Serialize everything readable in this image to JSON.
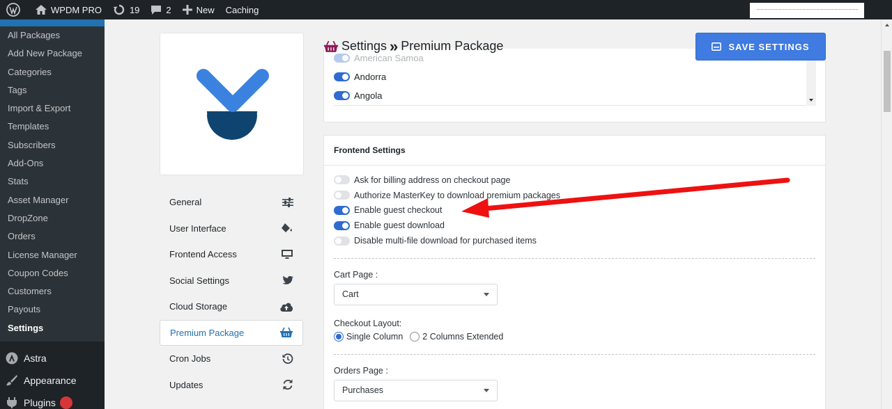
{
  "adminbar": {
    "site_name": "WPDM PRO",
    "updates_count": "19",
    "comments_count": "2",
    "new_label": "New",
    "caching_label": "Caching"
  },
  "adminmenu": {
    "submenu": [
      "All Packages",
      "Add New Package",
      "Categories",
      "Tags",
      "Import & Export",
      "Templates",
      "Subscribers",
      "Add-Ons",
      "Stats",
      "Asset Manager",
      "DropZone",
      "Orders",
      "License Manager",
      "Coupon Codes",
      "Customers",
      "Payouts",
      "Settings"
    ],
    "active": "Settings",
    "astra": "Astra",
    "appearance": "Appearance",
    "plugins": "Plugins"
  },
  "settings_nav": {
    "items": [
      "General",
      "User Interface",
      "Frontend Access",
      "Social Settings",
      "Cloud Storage",
      "Premium Package",
      "Cron Jobs",
      "Updates"
    ],
    "active": "Premium Package"
  },
  "header": {
    "title": "Settings",
    "separator": "»",
    "subtitle": "Premium Package",
    "save_label": "SAVE SETTINGS"
  },
  "countries": [
    {
      "name": "American Samoa",
      "on": true
    },
    {
      "name": "Andorra",
      "on": true
    },
    {
      "name": "Angola",
      "on": true
    }
  ],
  "frontend": {
    "heading": "Frontend Settings",
    "options": [
      {
        "label": "Ask for billing address on checkout page",
        "on": false
      },
      {
        "label": "Authorize MasterKey to download premium packages",
        "on": false
      },
      {
        "label": "Enable guest checkout",
        "on": true
      },
      {
        "label": "Enable guest download",
        "on": true
      },
      {
        "label": "Disable multi-file download for purchased items",
        "on": false
      }
    ],
    "cart_page_label": "Cart Page :",
    "cart_page_value": "Cart",
    "checkout_layout_label": "Checkout Layout:",
    "layout_single": "Single Column",
    "layout_double": "2 Columns Extended",
    "orders_page_label": "Orders Page :",
    "orders_page_value": "Purchases"
  },
  "colors": {
    "accent": "#3f7be0",
    "menu_bg": "#1d2327",
    "arrow": "#ee1111"
  }
}
